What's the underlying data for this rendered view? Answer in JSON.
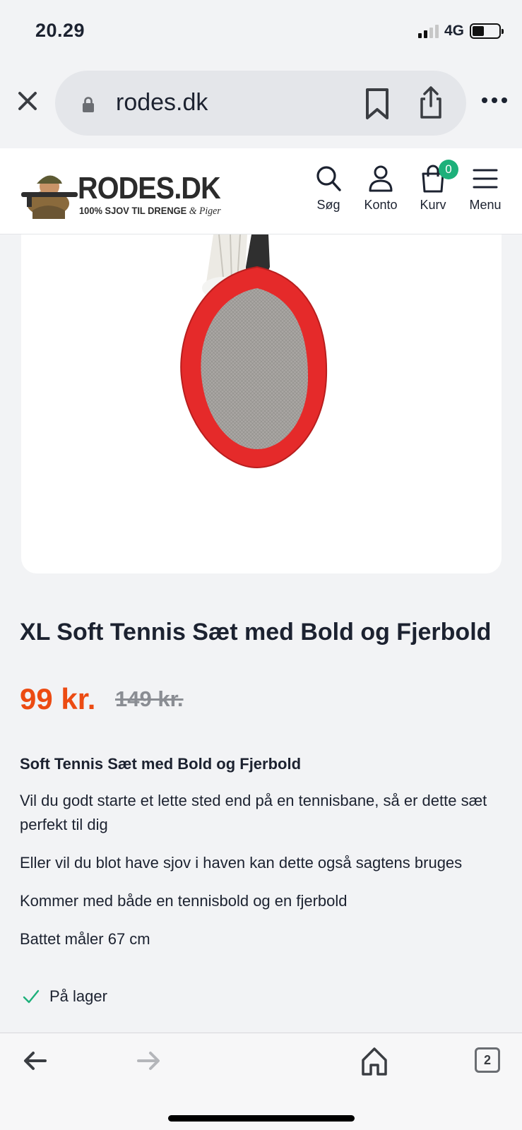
{
  "status_bar": {
    "time": "20.29",
    "network": "4G",
    "icons": [
      "signal-icon",
      "battery-icon"
    ]
  },
  "browser": {
    "url": "rodes.dk",
    "icons": [
      "close-icon",
      "lock-icon",
      "bookmark-icon",
      "share-icon",
      "more-icon"
    ]
  },
  "site_header": {
    "logo_name": "RODES.DK",
    "logo_tagline": "100% SJOV TIL DRENGE",
    "logo_tagline_script": "& Piger",
    "nav": {
      "search": "Søg",
      "account": "Konto",
      "cart": "Kurv",
      "cart_count": "0",
      "menu": "Menu"
    }
  },
  "product": {
    "title": "XL Soft Tennis Sæt med Bold og Fjerbold",
    "price": "99 kr.",
    "old_price": "149 kr.",
    "description_heading": "Soft Tennis Sæt med Bold og Fjerbold",
    "description_paragraphs": [
      "Vil du godt starte et lette sted end på en tennisbane, så er dette sæt perfekt til dig",
      "Eller vil du blot have sjov i haven kan dette også sagtens bruges",
      "Kommer med både en tennisbold og en fjerbold",
      "Battet måler 67 cm"
    ],
    "stock_status": "På lager"
  },
  "toolbar": {
    "tabs_count": "2",
    "icons": [
      "back-arrow-icon",
      "forward-arrow-icon",
      "home-icon",
      "tabs-icon"
    ]
  },
  "colors": {
    "price": "#ec4b12",
    "cart_badge": "#1db07a",
    "stock_check": "#1db07a",
    "racket_frame": "#e52a2a"
  }
}
